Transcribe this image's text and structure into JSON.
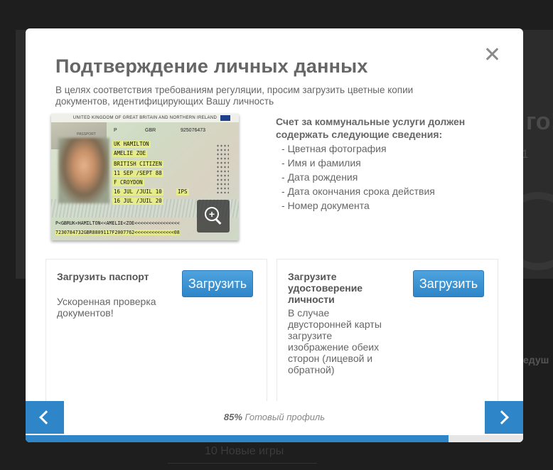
{
  "background": {
    "greeting_fragment": "го!",
    "digit_fragment": "1",
    "side_fragment": "едуш",
    "bottom_link": "10 Новые игры"
  },
  "modal": {
    "title": "Подтверждение личных данных",
    "subtitle": "В целях соответствия требованиям регуляции, просим загрузить цветные копии документов, идентифицирующих Вашу личность",
    "passport_sample": {
      "header": "UNITED KINGDOM OF GREAT BRITAIN AND NORTHERN IRELAND",
      "label_passport": "PASSPORT",
      "type": "P",
      "code": "GBR",
      "number": "925076473",
      "surname": "UK HAMILTON",
      "given_names": "AMELIE ZOE",
      "nationality": "BRITISH CITIZEN",
      "birth_date": "11 SEP /SEPT 88",
      "sex_place": "F      CROYDON",
      "issue_date": "16 JUL /JUIL 10",
      "issue_code": "IPS",
      "expiry_date": "16 JUL /JUIL 20",
      "mrz_line1": "P<GBRUK<HAMILTON<<AMELIE<ZOE<<<<<<<<<<<<<<<<",
      "mrz_line2": "7230784732GBR8809117F2007762<<<<<<<<<<<<<<08"
    },
    "requirements": {
      "title": "Счет за коммунальные услуги должен содержать следующие сведения:",
      "items": [
        "Цветная фотография",
        "Имя и фамилия",
        "Дата рождения",
        "Дата окончания срока действия",
        "Номер документа"
      ]
    },
    "cards": [
      {
        "title": "Загрузить паспорт",
        "description": "Ускоренная проверка документов!",
        "button": "Загрузить"
      },
      {
        "title": "Загрузите удостоверение личности",
        "description": "В случае двусторонней карты загрузите изображение обеих сторон (лицевой и обратной)",
        "button": "Загрузить"
      }
    ],
    "progress": {
      "percent_label": "85%",
      "label": "Готовый профиль",
      "fraction": 0.85
    }
  },
  "colors": {
    "accent": "#2e86c9",
    "overlay": "#1e1e1e",
    "text": "#666666"
  }
}
